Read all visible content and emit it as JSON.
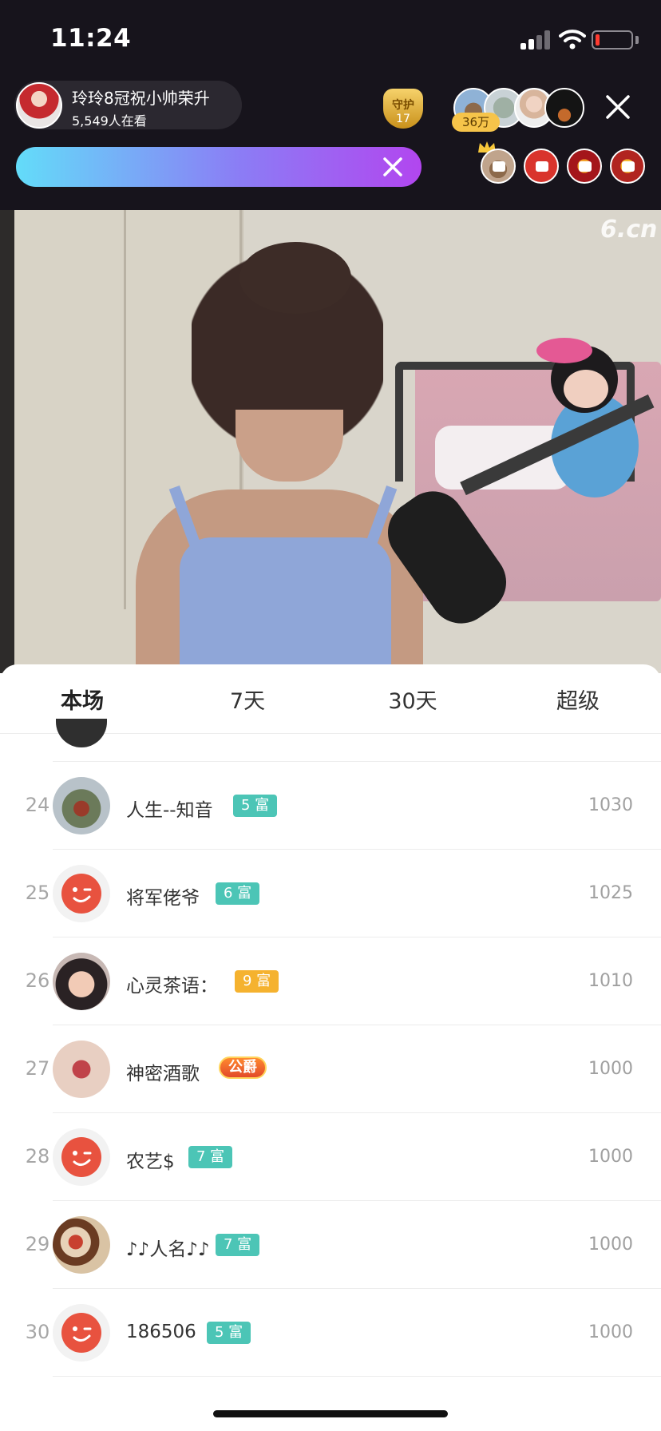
{
  "status_bar": {
    "time": "11:24"
  },
  "host": {
    "name": "玲玲8冠祝小帅荣升",
    "viewers": "5,549人在看"
  },
  "guard": {
    "label": "守护",
    "count": "17"
  },
  "audience": {
    "badge": "36万"
  },
  "watermark": "6.cn",
  "tabs": [
    {
      "label": "本场",
      "active": true
    },
    {
      "label": "7天",
      "active": false
    },
    {
      "label": "30天",
      "active": false
    },
    {
      "label": "超级",
      "active": false
    }
  ],
  "ranking": [
    {
      "rank": "24",
      "name": "人生--知音",
      "badge": "5 富",
      "badge_color": "#4cc5b6",
      "score": "1030",
      "avatar": "photo-outdoor"
    },
    {
      "rank": "25",
      "name": "将军佬爷",
      "badge": "6 富",
      "badge_color": "#4cc5b6",
      "score": "1025",
      "avatar": "default-smiley"
    },
    {
      "rank": "26",
      "name": "心灵茶语：",
      "badge": "9 富",
      "badge_color": "#f5b22f",
      "score": "1010",
      "avatar": "photo-woman"
    },
    {
      "rank": "27",
      "name": "神密酒歌",
      "badge": "公爵",
      "badge_color": "#e2492a",
      "score": "1000",
      "avatar": "photo-lips"
    },
    {
      "rank": "28",
      "name": "农艺$",
      "badge": "7 富",
      "badge_color": "#4cc5b6",
      "score": "1000",
      "avatar": "default-smiley"
    },
    {
      "rank": "29",
      "name": "♪♪人名♪♪",
      "badge": "7 富",
      "badge_color": "#4cc5b6",
      "score": "1000",
      "avatar": "photo-food"
    },
    {
      "rank": "30",
      "name": "186506",
      "badge": "5 富",
      "badge_color": "#4cc5b6",
      "score": "1000",
      "avatar": "default-smiley"
    }
  ]
}
